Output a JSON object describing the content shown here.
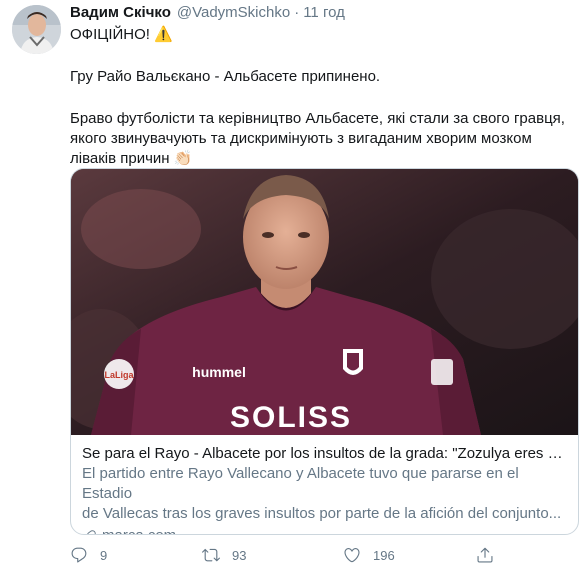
{
  "tweet": {
    "author_name": "Вадим Скічко",
    "author_handle": "@VadymSkichko",
    "separator": "·",
    "time": "11 год",
    "line1": "ОФІЦІЙНО! ⚠️",
    "line2": "Гру Райо Вальєкано - Альбасете припинено.",
    "line3": "Браво футболісти та керівництво Альбасете, які стали за свого гравця,",
    "line4": "якого звинувачують та дискримінують з вигаданим хворим мозком",
    "line5": "ліваків причин 👏🏻"
  },
  "card": {
    "image_icon": "football-player-photo",
    "jersey_text": "SOLISS",
    "jersey_brand": "hummel",
    "sleeve_text": "LaLiga",
    "title": "Se para el Rayo - Albacete por los insultos de la grada: \"Zozulya eres un...",
    "desc_line1": "El partido entre Rayo Vallecano y Albacete tuvo que pararse en el Estadio",
    "desc_line2": "de Vallecas tras los graves insultos por parte de la afición del conjunto...",
    "domain": "marca.com",
    "domain_icon": "link-icon"
  },
  "actions": {
    "reply_count": "9",
    "retweet_count": "93",
    "like_count": "196",
    "reply_icon": "reply-icon",
    "retweet_icon": "retweet-icon",
    "like_icon": "heart-icon",
    "share_icon": "share-icon"
  },
  "colors": {
    "text": "#14171a",
    "secondary": "#657786",
    "border": "#ccd6dd",
    "jersey": "#6e2443"
  }
}
